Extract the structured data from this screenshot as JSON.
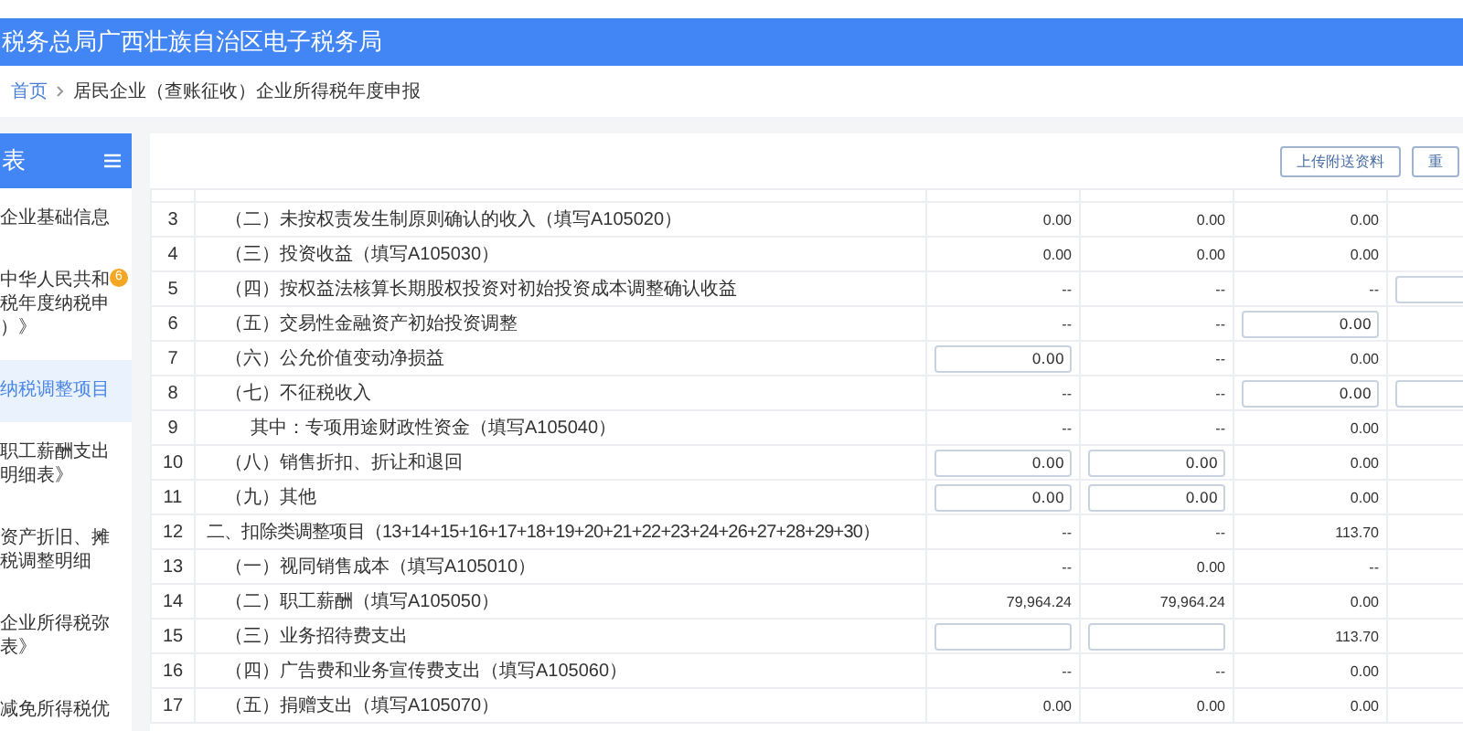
{
  "header": {
    "title": "税务总局广西壮族自治区电子税务局"
  },
  "breadcrumb": {
    "home": "首页",
    "current": "居民企业（查账征收）企业所得税年度申报"
  },
  "sidebar": {
    "title": "表",
    "items": [
      {
        "lines": [
          "企业基础信息"
        ],
        "selected": false
      },
      {
        "lines": [
          "中华人民共和",
          "税年度纳税申",
          "）》"
        ],
        "selected": false,
        "badge": "6"
      },
      {
        "lines": [
          "纳税调整项目"
        ],
        "selected": true
      },
      {
        "lines": [
          "职工薪酬支出",
          "明细表》"
        ],
        "selected": false
      },
      {
        "lines": [
          "资产折旧、摊",
          "税调整明细"
        ],
        "selected": false
      },
      {
        "lines": [
          "企业所得税弥",
          "表》"
        ],
        "selected": false
      },
      {
        "lines": [
          "减免所得税优"
        ],
        "selected": false
      }
    ]
  },
  "toolbar": {
    "buttons": [
      "上传附送资料",
      "重"
    ]
  },
  "table": {
    "rows": [
      {
        "no": "3",
        "item": "（二）未按权责发生制原则确认的收入（填写A105020）",
        "kind": "item",
        "cells": [
          {
            "kind": "text",
            "value": "0.00"
          },
          {
            "kind": "text",
            "value": "0.00"
          },
          {
            "kind": "text",
            "value": "0.00"
          }
        ]
      },
      {
        "no": "4",
        "item": "（三）投资收益（填写A105030）",
        "kind": "item",
        "cells": [
          {
            "kind": "text",
            "value": "0.00"
          },
          {
            "kind": "text",
            "value": "0.00"
          },
          {
            "kind": "text",
            "value": "0.00"
          }
        ]
      },
      {
        "no": "5",
        "item": "（四）按权益法核算长期股权投资对初始投资成本调整确认收益",
        "kind": "item",
        "cells": [
          {
            "kind": "text",
            "value": "--"
          },
          {
            "kind": "text",
            "value": "--"
          },
          {
            "kind": "text",
            "value": "--"
          },
          {
            "kind": "input"
          }
        ]
      },
      {
        "no": "6",
        "item": "（五）交易性金融资产初始投资调整",
        "kind": "item",
        "cells": [
          {
            "kind": "text",
            "value": "--"
          },
          {
            "kind": "text",
            "value": "--"
          },
          {
            "kind": "input",
            "value": "0.00"
          }
        ]
      },
      {
        "no": "7",
        "item": "（六）公允价值变动净损益",
        "kind": "item",
        "cells": [
          {
            "kind": "input",
            "value": "0.00"
          },
          {
            "kind": "text",
            "value": "--"
          },
          {
            "kind": "text",
            "value": "0.00"
          }
        ]
      },
      {
        "no": "8",
        "item": "（七）不征税收入",
        "kind": "item",
        "cells": [
          {
            "kind": "text",
            "value": "--"
          },
          {
            "kind": "text",
            "value": "--"
          },
          {
            "kind": "input",
            "value": "0.00"
          },
          {
            "kind": "input"
          }
        ]
      },
      {
        "no": "9",
        "item": "其中：专项用途财政性资金（填写A105040）",
        "kind": "sub",
        "cells": [
          {
            "kind": "text",
            "value": "--"
          },
          {
            "kind": "text",
            "value": "--"
          },
          {
            "kind": "text",
            "value": "0.00"
          }
        ]
      },
      {
        "no": "10",
        "item": "（八）销售折扣、折让和退回",
        "kind": "item",
        "cells": [
          {
            "kind": "input",
            "value": "0.00"
          },
          {
            "kind": "input",
            "value": "0.00"
          },
          {
            "kind": "text",
            "value": "0.00"
          }
        ]
      },
      {
        "no": "11",
        "item": "（九）其他",
        "kind": "item",
        "cells": [
          {
            "kind": "input",
            "value": "0.00"
          },
          {
            "kind": "input",
            "value": "0.00"
          },
          {
            "kind": "text",
            "value": "0.00"
          }
        ]
      },
      {
        "no": "12",
        "item": "二、扣除类调整项目（13+14+15+16+17+18+19+20+21+22+23+24+26+27+28+29+30）",
        "kind": "section",
        "cells": [
          {
            "kind": "text",
            "value": "--"
          },
          {
            "kind": "text",
            "value": "--"
          },
          {
            "kind": "text",
            "value": "113.70"
          }
        ]
      },
      {
        "no": "13",
        "item": "（一）视同销售成本（填写A105010）",
        "kind": "item",
        "cells": [
          {
            "kind": "text",
            "value": "--"
          },
          {
            "kind": "text",
            "value": "0.00"
          },
          {
            "kind": "text",
            "value": "--"
          }
        ]
      },
      {
        "no": "14",
        "item": "（二）职工薪酬（填写A105050）",
        "kind": "item",
        "cells": [
          {
            "kind": "text",
            "value": "79,964.24"
          },
          {
            "kind": "text",
            "value": "79,964.24"
          },
          {
            "kind": "text",
            "value": "0.00"
          }
        ]
      },
      {
        "no": "15",
        "item": "（三）业务招待费支出",
        "kind": "item",
        "cells": [
          {
            "kind": "input"
          },
          {
            "kind": "input"
          },
          {
            "kind": "text",
            "value": "113.70"
          }
        ]
      },
      {
        "no": "16",
        "item": "（四）广告费和业务宣传费支出（填写A105060）",
        "kind": "item",
        "cells": [
          {
            "kind": "text",
            "value": "--"
          },
          {
            "kind": "text",
            "value": "--"
          },
          {
            "kind": "text",
            "value": "0.00"
          }
        ]
      },
      {
        "no": "17",
        "item": "（五）捐赠支出（填写A105070）",
        "kind": "item",
        "cells": [
          {
            "kind": "text",
            "value": "0.00"
          },
          {
            "kind": "text",
            "value": "0.00"
          },
          {
            "kind": "text",
            "value": "0.00"
          }
        ]
      }
    ]
  }
}
